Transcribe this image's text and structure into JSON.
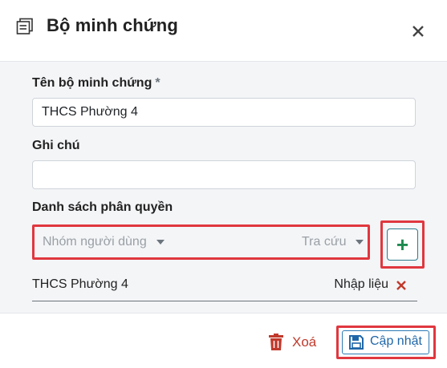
{
  "dialog": {
    "title": "Bộ minh chứng",
    "title_icon": "window-list-icon",
    "close_icon": "close-icon"
  },
  "form": {
    "name_label": "Tên bộ minh chứng",
    "required_mark": "*",
    "name_value": "THCS Phường 4",
    "note_label": "Ghi chú",
    "note_value": "",
    "permissions_label": "Danh sách phân quyền",
    "group_select_placeholder": "Nhóm người dùng",
    "role_select_placeholder": "Tra cứu",
    "add_icon": "plus-icon",
    "permissions": [
      {
        "group": "THCS Phường 4",
        "role": "Nhập liệu"
      }
    ]
  },
  "footer": {
    "delete_label": "Xoá",
    "delete_icon": "trash-icon",
    "update_label": "Cập nhật",
    "update_icon": "save-icon"
  },
  "colors": {
    "highlight": "#e0373f",
    "danger": "#c0392b",
    "primary": "#1f66a8",
    "success": "#1e8a4f"
  }
}
